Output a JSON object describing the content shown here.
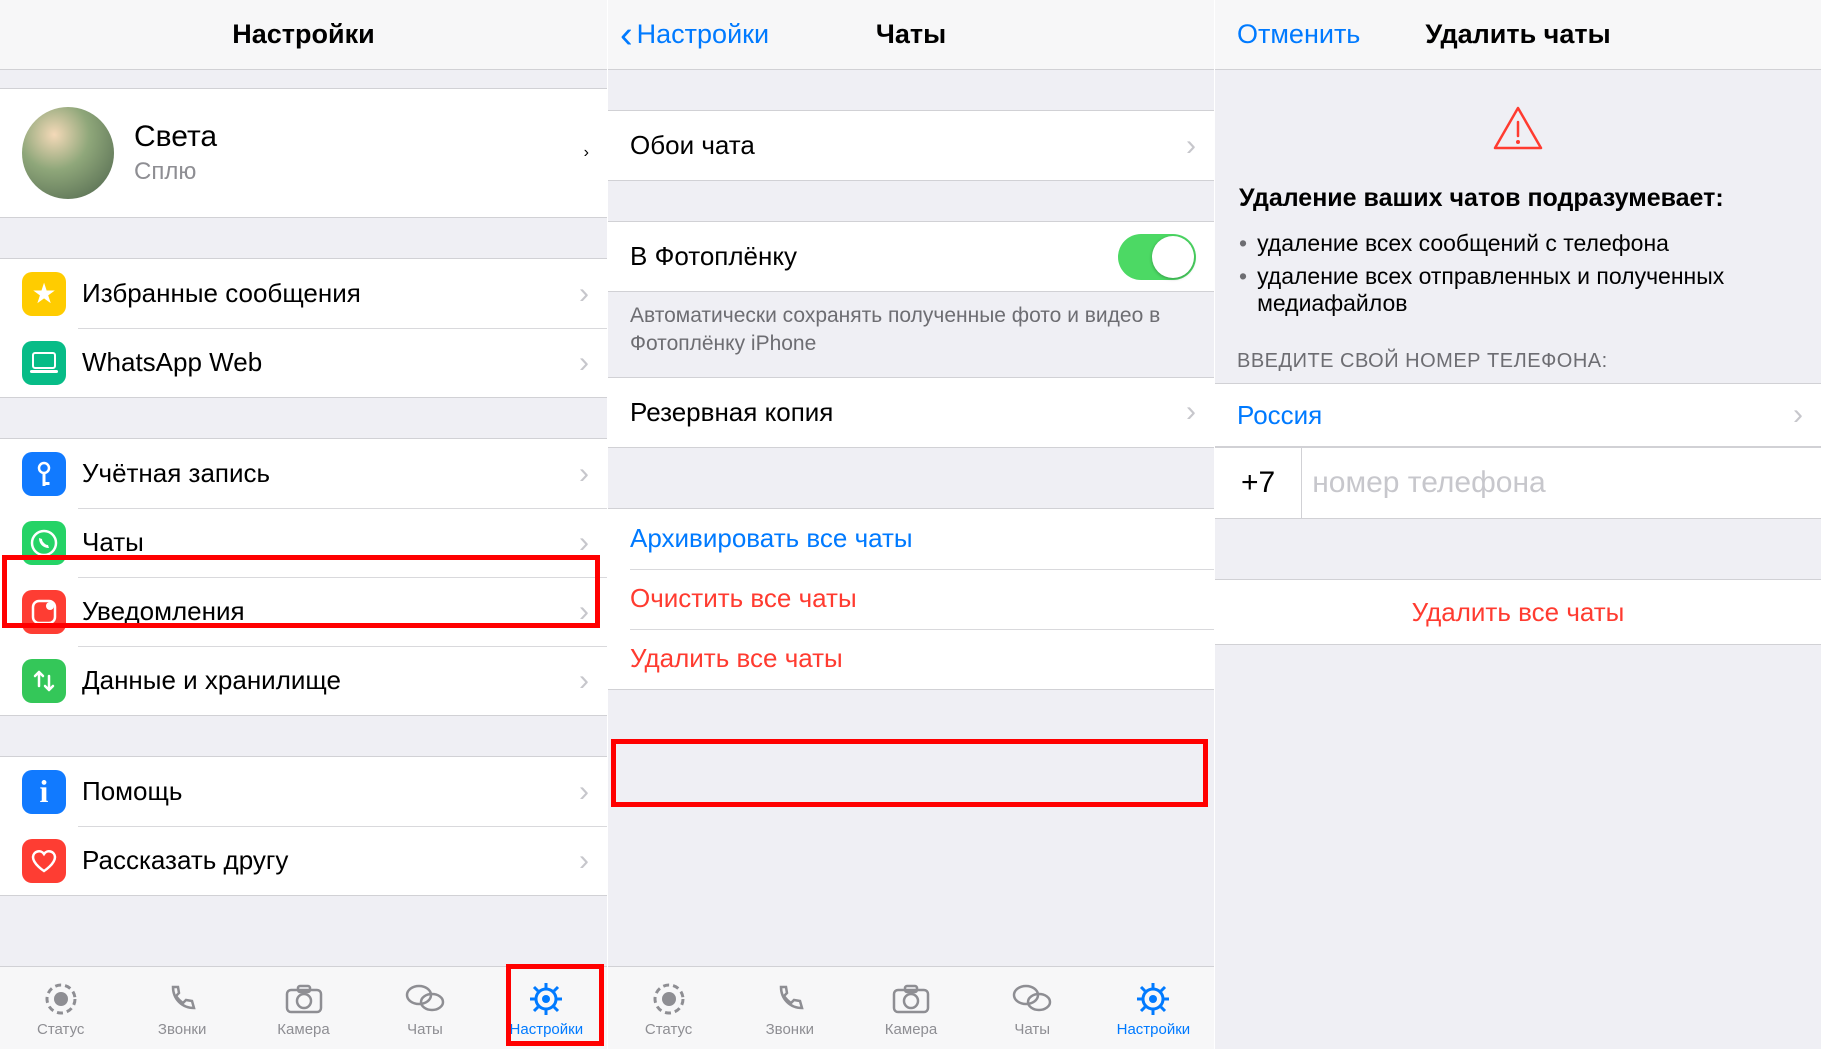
{
  "screen1": {
    "title": "Настройки",
    "profile": {
      "name": "Света",
      "status": "Сплю"
    },
    "rows": {
      "starred": "Избранные сообщения",
      "web": "WhatsApp Web",
      "account": "Учётная запись",
      "chats": "Чаты",
      "notif": "Уведомления",
      "data": "Данные и хранилище",
      "help": "Помощь",
      "tell": "Рассказать другу"
    }
  },
  "screen2": {
    "back": "Настройки",
    "title": "Чаты",
    "rows": {
      "wallpaper": "Обои чата",
      "camroll": "В Фотоплёнку",
      "camroll_footer": "Автоматически сохранять полученные фото и видео в Фотоплёнку iPhone",
      "backup": "Резервная копия",
      "archive": "Архивировать все чаты",
      "clear": "Очистить все чаты",
      "delete": "Удалить все чаты"
    }
  },
  "screen3": {
    "cancel": "Отменить",
    "title": "Удалить чаты",
    "heading": "Удаление ваших чатов подразумевает:",
    "bullet1": "удаление всех сообщений с телефона",
    "bullet2": "удаление всех отправленных и полученных медиафайлов",
    "phone_header": "ВВЕДИТЕ СВОЙ НОМЕР ТЕЛЕФОНА:",
    "country": "Россия",
    "cc": "+7",
    "phone_placeholder": "номер телефона",
    "delete_all": "Удалить все чаты"
  },
  "tabs": {
    "status": "Статус",
    "calls": "Звонки",
    "camera": "Камера",
    "chats": "Чаты",
    "settings": "Настройки"
  }
}
